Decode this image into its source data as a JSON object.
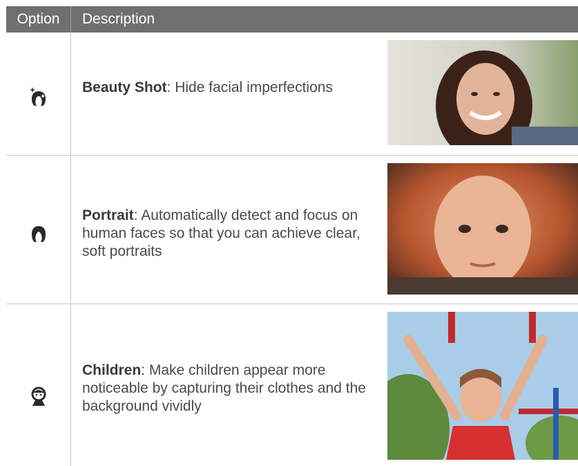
{
  "header": {
    "option_label": "Option",
    "description_label": "Description"
  },
  "rows": [
    {
      "title": "Beauty Shot",
      "separator": ":",
      "text": " Hide facial imperfections",
      "icon": "beauty-shot-icon"
    },
    {
      "title": "Portrait",
      "separator": ":",
      "text": " Automatically detect and focus on human faces so that you can achieve clear, soft portraits",
      "icon": "portrait-icon"
    },
    {
      "title": "Children",
      "separator": ":",
      "text": " Make children appear more noticeable by capturing their clothes and the background vividly",
      "icon": "children-icon"
    }
  ],
  "colors": {
    "header_bg": "#6f6f6f",
    "header_text": "#ffffff",
    "body_text": "#4a4a4a",
    "rule": "#c8c8c8"
  }
}
